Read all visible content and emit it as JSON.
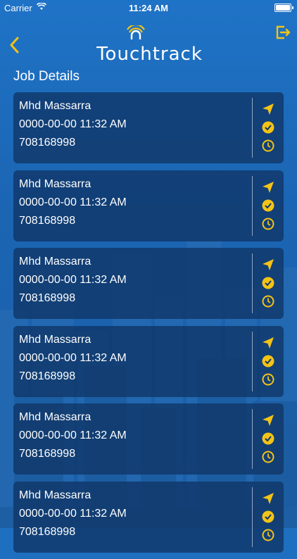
{
  "status_bar": {
    "carrier": "Carrier",
    "time": "11:24 AM"
  },
  "header": {
    "logo_text": "Touchtrack",
    "back_icon": "chevron-left-icon",
    "logout_icon": "logout-icon"
  },
  "section_title": "Job Details",
  "colors": {
    "accent": "#f3c316",
    "card_bg": "#103769",
    "background": "#1f6fc0"
  },
  "jobs": [
    {
      "name": "Mhd Massarra",
      "datetime": "0000-00-00 11:32 AM",
      "phone": "708168998"
    },
    {
      "name": "Mhd Massarra",
      "datetime": "0000-00-00 11:32 AM",
      "phone": "708168998"
    },
    {
      "name": "Mhd Massarra",
      "datetime": "0000-00-00 11:32 AM",
      "phone": "708168998"
    },
    {
      "name": "Mhd Massarra",
      "datetime": "0000-00-00 11:32 AM",
      "phone": "708168998"
    },
    {
      "name": "Mhd Massarra",
      "datetime": "0000-00-00 11:32 AM",
      "phone": "708168998"
    },
    {
      "name": "Mhd Massarra",
      "datetime": "0000-00-00 11:32 AM",
      "phone": "708168998"
    }
  ]
}
